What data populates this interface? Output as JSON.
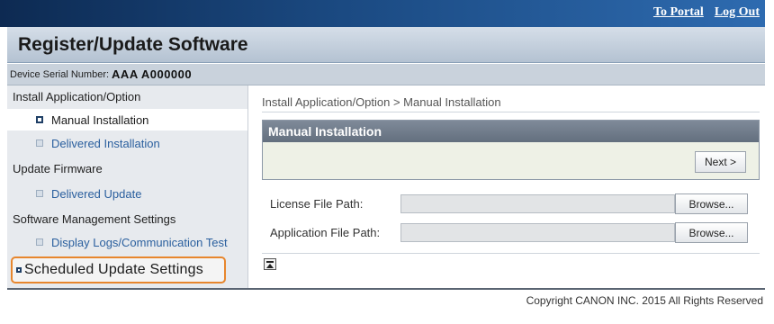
{
  "header": {
    "links": [
      "To Portal",
      "Log Out"
    ],
    "title": "Register/Update Software"
  },
  "device": {
    "serial_label": "Device Serial Number:",
    "serial_value": "AAA A000000"
  },
  "sidebar": {
    "sections": [
      {
        "label": "Install Application/Option",
        "items": [
          {
            "label": "Manual Installation",
            "active": true
          },
          {
            "label": "Delivered Installation",
            "active": false
          }
        ]
      },
      {
        "label": "Update Firmware",
        "items": [
          {
            "label": "Delivered Update",
            "active": false
          }
        ]
      },
      {
        "label": "Software Management Settings",
        "items": [
          {
            "label": "Display Logs/Communication Test",
            "active": false
          }
        ]
      }
    ],
    "highlighted_item": "Scheduled Update Settings"
  },
  "main": {
    "breadcrumb": "Install Application/Option > Manual Installation",
    "panel_title": "Manual Installation",
    "next_label": "Next >",
    "fields": [
      {
        "label": "License File Path:",
        "value": "",
        "button": "Browse..."
      },
      {
        "label": "Application File Path:",
        "value": "",
        "button": "Browse..."
      }
    ],
    "top_icon": "page-top-icon"
  },
  "footer": {
    "copyright": "Copyright CANON INC. 2015 All Rights Reserved"
  },
  "colors": {
    "highlight_border": "#e7862d",
    "link_blue": "#2a5f9e",
    "panel_header": "#6b7685"
  }
}
